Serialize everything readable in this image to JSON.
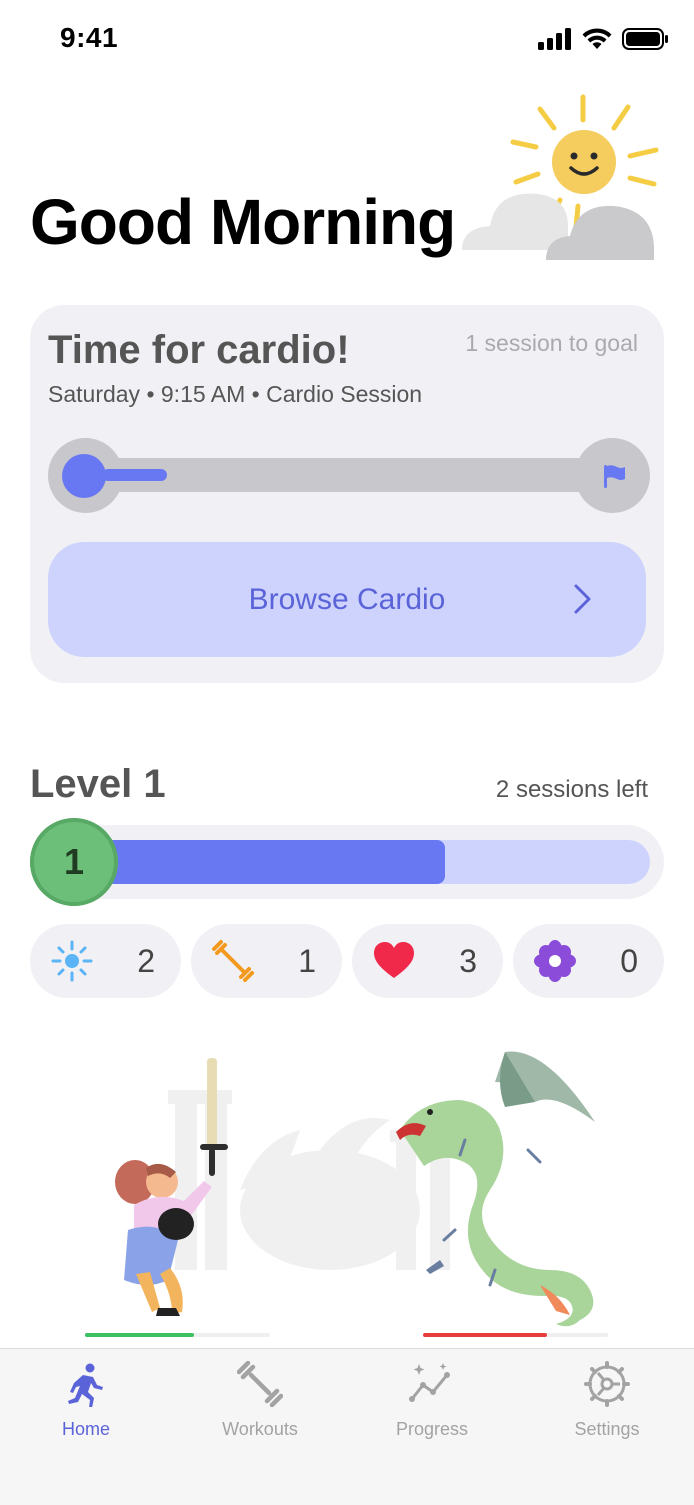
{
  "status_bar": {
    "time": "9:41"
  },
  "greeting": "Good Morning",
  "goal_card": {
    "title": "Time for cardio!",
    "remaining": "1 session to goal",
    "subtitle": "Saturday • 9:15 AM • Cardio Session",
    "progress": 0.12,
    "button_label": "Browse Cardio"
  },
  "level": {
    "title": "Level 1",
    "sessions_left": "2 sessions left",
    "badge": "1",
    "progress": 0.66
  },
  "stats": [
    {
      "icon": "sparkle-icon",
      "value": "2",
      "color": "#5ab4f5"
    },
    {
      "icon": "dumbbell-icon",
      "value": "1",
      "color": "#f39a1e"
    },
    {
      "icon": "heart-icon",
      "value": "3",
      "color": "#f0284a"
    },
    {
      "icon": "flower-icon",
      "value": "0",
      "color": "#8a4cd9"
    }
  ],
  "battle": {
    "hero_health": 0.59,
    "dragon_health": 0.67
  },
  "tabs": [
    {
      "label": "Home",
      "icon": "runner-icon",
      "active": true
    },
    {
      "label": "Workouts",
      "icon": "dumbbell-icon"
    },
    {
      "label": "Progress",
      "icon": "chart-sparkle-icon"
    },
    {
      "label": "Settings",
      "icon": "gear-icon"
    }
  ],
  "colors": {
    "accent": "#6878f2",
    "accent_light": "#cdd3fd",
    "card": "#f1f1f5"
  }
}
